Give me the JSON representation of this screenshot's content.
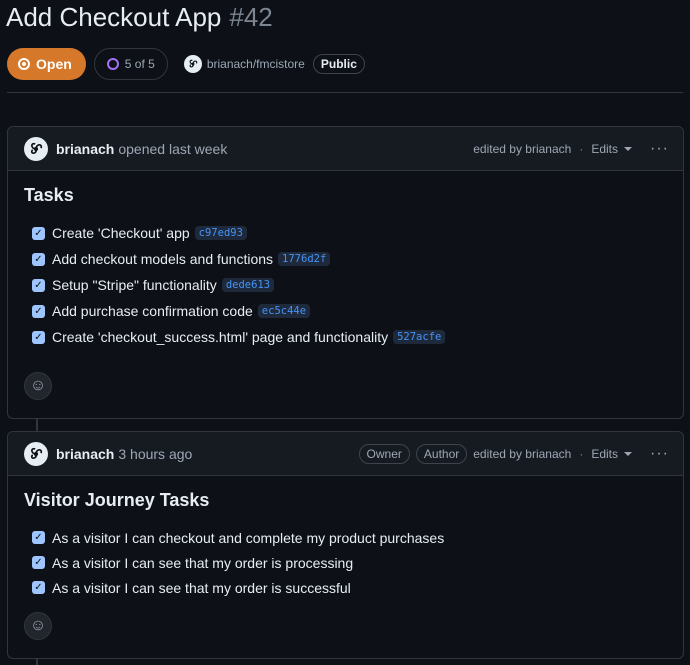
{
  "issue": {
    "title": "Add Checkout App",
    "number": "#42",
    "state": "Open",
    "progress": "5 of 5",
    "repo": "brianach/fmcistore",
    "visibility": "Public"
  },
  "comments": [
    {
      "author": "brianach",
      "timestamp": "opened last week",
      "edited": "edited by brianach",
      "edits_label": "Edits",
      "heading": "Tasks",
      "tasks": [
        {
          "text": "Create 'Checkout' app",
          "sha": "c97ed93",
          "checked": true
        },
        {
          "text": "Add checkout models and functions",
          "sha": "1776d2f",
          "checked": true
        },
        {
          "text": "Setup \"Stripe\" functionality",
          "sha": "dede613",
          "checked": true
        },
        {
          "text": "Add purchase confirmation code",
          "sha": "ec5c44e",
          "checked": true
        },
        {
          "text": "Create 'checkout_success.html' page and functionality",
          "sha": "527acfe",
          "checked": true
        }
      ]
    },
    {
      "author": "brianach",
      "timestamp": "3 hours ago",
      "badges": [
        "Owner",
        "Author"
      ],
      "edited": "edited by brianach",
      "edits_label": "Edits",
      "heading": "Visitor Journey Tasks",
      "tasks": [
        {
          "text": "As a visitor I can checkout and complete my product purchases",
          "checked": true
        },
        {
          "text": "As a visitor I can see that my order is processing",
          "checked": true
        },
        {
          "text": "As a visitor I can see that my order is successful",
          "checked": true
        }
      ]
    }
  ],
  "icons": {
    "open": "issue-opened-icon",
    "progress": "progress-ring-icon",
    "avatar": "triskelion-avatar-icon",
    "reaction": "smiley-icon",
    "more": "kebab-horizontal-icon"
  },
  "colors": {
    "open_badge": "#d5782a",
    "progress_ring": "#a371f7",
    "link": "#4493f8",
    "checkbox": "#9ec5fe",
    "background": "#0d1117"
  }
}
